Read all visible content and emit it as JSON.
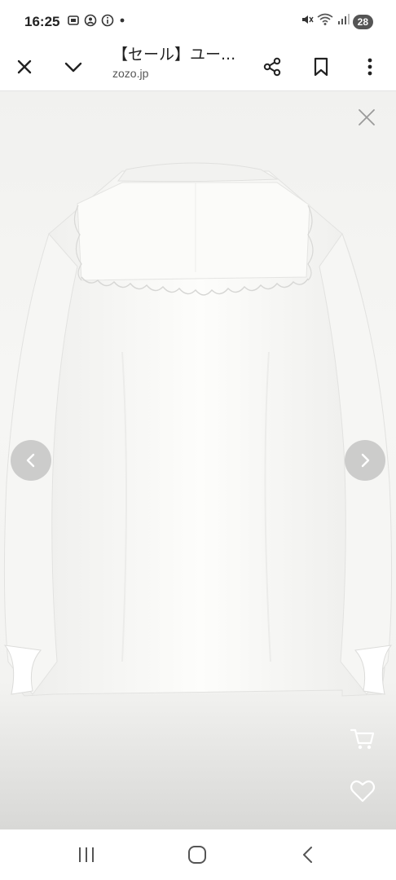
{
  "status_bar": {
    "time": "16:25",
    "battery": "28",
    "left_icons": [
      "screenshot-icon",
      "assistant-icon",
      "info-icon",
      "dot-icon"
    ],
    "right_icons": [
      "mute-icon",
      "wifi-icon",
      "signal-icon"
    ]
  },
  "toolbar": {
    "title": "【セール】ユー...",
    "url": "zozo.jp",
    "icons": [
      "close-icon",
      "chevron-down-icon",
      "share-icon",
      "bookmark-icon",
      "more-vert-icon"
    ]
  },
  "viewer": {
    "image_subject": "white blouse with ruffled collar, back view",
    "controls": [
      "viewer-close-icon",
      "prev-arrow-icon",
      "next-arrow-icon",
      "cart-icon",
      "heart-icon"
    ]
  },
  "navbar": {
    "buttons": [
      "recents-icon",
      "home-icon",
      "back-icon"
    ]
  },
  "colors": {
    "background": "#f3f3f1",
    "blouse": "#fbfbf9",
    "nav_arrow_bg": "#aaaaaa",
    "icon_dark": "#222222",
    "icon_light": "#ffffff"
  }
}
